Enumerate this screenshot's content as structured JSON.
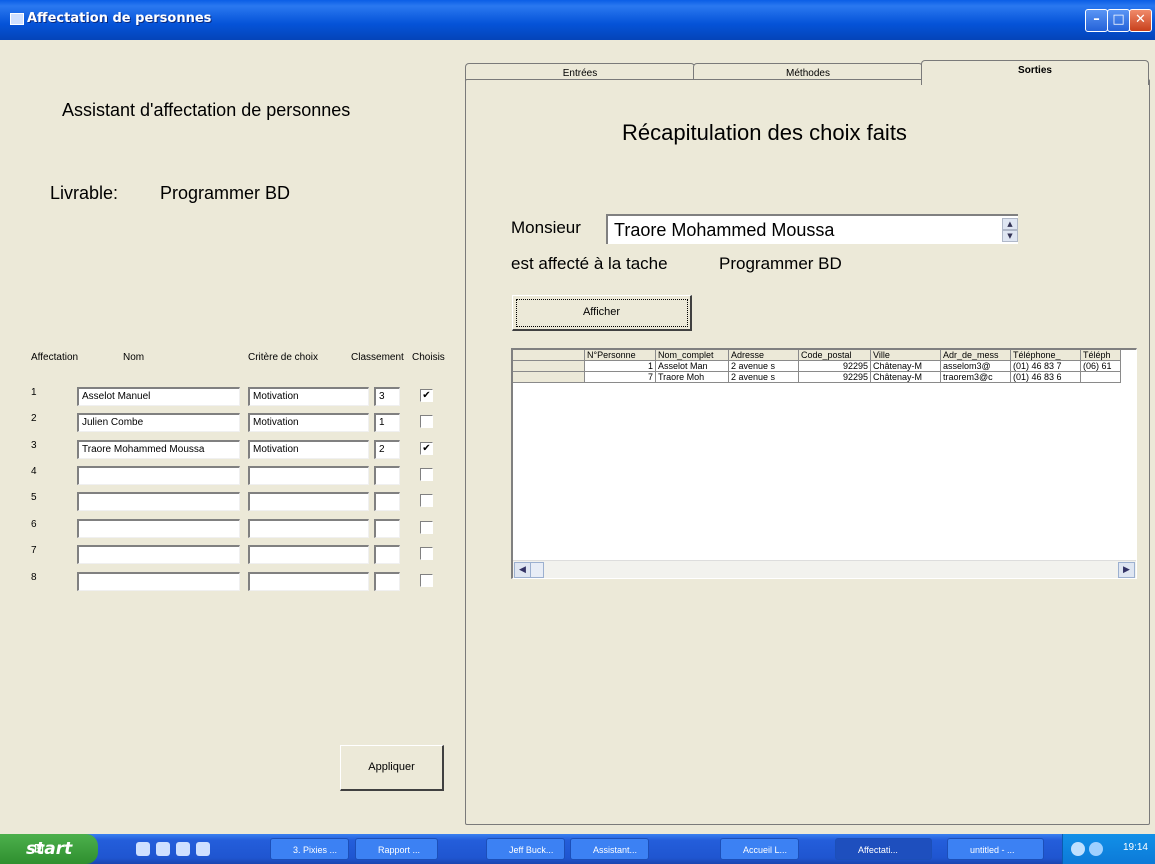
{
  "window": {
    "title": "Affectation de personnes"
  },
  "left": {
    "title": "Assistant d'affectation de personnes",
    "livrable_label": "Livrable:",
    "livrable_value": "Programmer BD",
    "headers": [
      "Affectation",
      "Nom",
      "Critère de choix",
      "Classement",
      "Choisis"
    ],
    "rows": [
      {
        "n": "1",
        "nom": "Asselot Manuel",
        "critere": "Motivation",
        "classement": "3",
        "checked": true
      },
      {
        "n": "2",
        "nom": "Julien Combe",
        "critere": "Motivation",
        "classement": "1",
        "checked": false
      },
      {
        "n": "3",
        "nom": "Traore Mohammed Moussa",
        "critere": "Motivation",
        "classement": "2",
        "checked": true
      },
      {
        "n": "4",
        "nom": "",
        "critere": "",
        "classement": "",
        "checked": false
      },
      {
        "n": "5",
        "nom": "",
        "critere": "",
        "classement": "",
        "checked": false
      },
      {
        "n": "6",
        "nom": "",
        "critere": "",
        "classement": "",
        "checked": false
      },
      {
        "n": "7",
        "nom": "",
        "critere": "",
        "classement": "",
        "checked": false
      },
      {
        "n": "8",
        "nom": "",
        "critere": "",
        "classement": "",
        "checked": false
      }
    ],
    "apply_label": "Appliquer"
  },
  "tabs": [
    {
      "label": "Entrées"
    },
    {
      "label": "Méthodes"
    },
    {
      "label": "Sorties"
    }
  ],
  "right": {
    "recap_title": "Récapitulation des choix faits",
    "monsieur_label": "Monsieur",
    "monsieur_value": "Traore Mohammed Moussa",
    "affect_text": "est affecté à la tache",
    "affect_task": "Programmer BD",
    "afficher_label": "Afficher",
    "grid_headers": [
      "",
      "N°Personne",
      "Nom_complet",
      "Adresse",
      "Code_postal",
      "Ville",
      "Adr_de_mess",
      "Téléphone_",
      "Téléph"
    ],
    "grid_rows": [
      [
        "",
        "1",
        "Asselot Man",
        "2 avenue s",
        "92295",
        "Châtenay-M",
        "asselom3@",
        "(01) 46 83 7",
        "(06) 61"
      ],
      [
        "",
        "7",
        "Traore Moh",
        "2 avenue s",
        "92295",
        "Châtenay-M",
        "traorem3@c",
        "(01) 46 83 6",
        ""
      ]
    ]
  },
  "taskbar": {
    "start_label": "start",
    "items": [
      "3. Pixies ...",
      "Rapport ...",
      "Jeff Buck...",
      "Assistant...",
      "Accueil L...",
      "Affectati...",
      "untitled - ..."
    ],
    "clock": "19:14"
  }
}
